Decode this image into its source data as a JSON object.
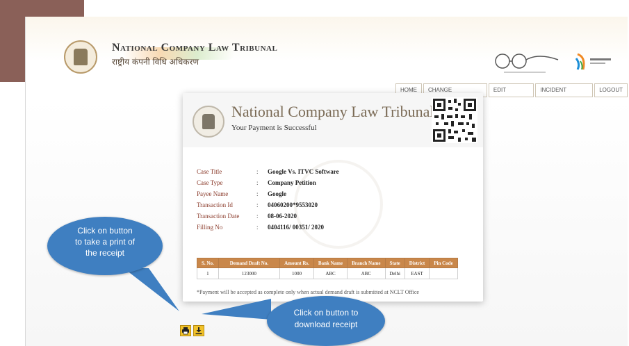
{
  "header": {
    "title": "National Company Law Tribunal",
    "subtitle_hindi": "राष्ट्रीय कंपनी विधि अधिकरण"
  },
  "nav": {
    "items": [
      "HOME",
      "CHANGE PASSWORD",
      "EDIT PROFILE",
      "INCIDENT REPORT",
      "LOGOUT"
    ]
  },
  "receipt": {
    "title": "National Company Law Tribunal",
    "subtitle": "Your Payment is Successful",
    "fields": [
      {
        "label": "Case Title",
        "value": "Google Vs. ITVC Software"
      },
      {
        "label": "Case Type",
        "value": "Company Petition"
      },
      {
        "label": "Payee Name",
        "value": "Google"
      },
      {
        "label": "Transaction Id",
        "value": "04060200*9553020"
      },
      {
        "label": "Transaction Date",
        "value": "08-06-2020"
      },
      {
        "label": "Filling No",
        "value": "0404116/ 00351/ 2020"
      }
    ],
    "table": {
      "headers": [
        "S. No.",
        "Demand Draft No.",
        "Amount Rs.",
        "Bank Name",
        "Branch Name",
        "State",
        "District",
        "Pin Code"
      ],
      "rows": [
        [
          "1",
          "123000",
          "1000",
          "ABC",
          "ABC",
          "Delhi",
          "EAST",
          ""
        ]
      ]
    },
    "note": "*Payment will be accepted as complete only when actual demand draft is submitted at NCLT Office"
  },
  "callouts": {
    "print": [
      "Click on button",
      "to take a print of",
      "the receipt"
    ],
    "download": [
      "Click on button to",
      "download receipt"
    ]
  },
  "colors": {
    "accent": "#c9874a",
    "callout": "#3f7fc1",
    "button": "#f1c22a",
    "corner": "#8a6058"
  }
}
